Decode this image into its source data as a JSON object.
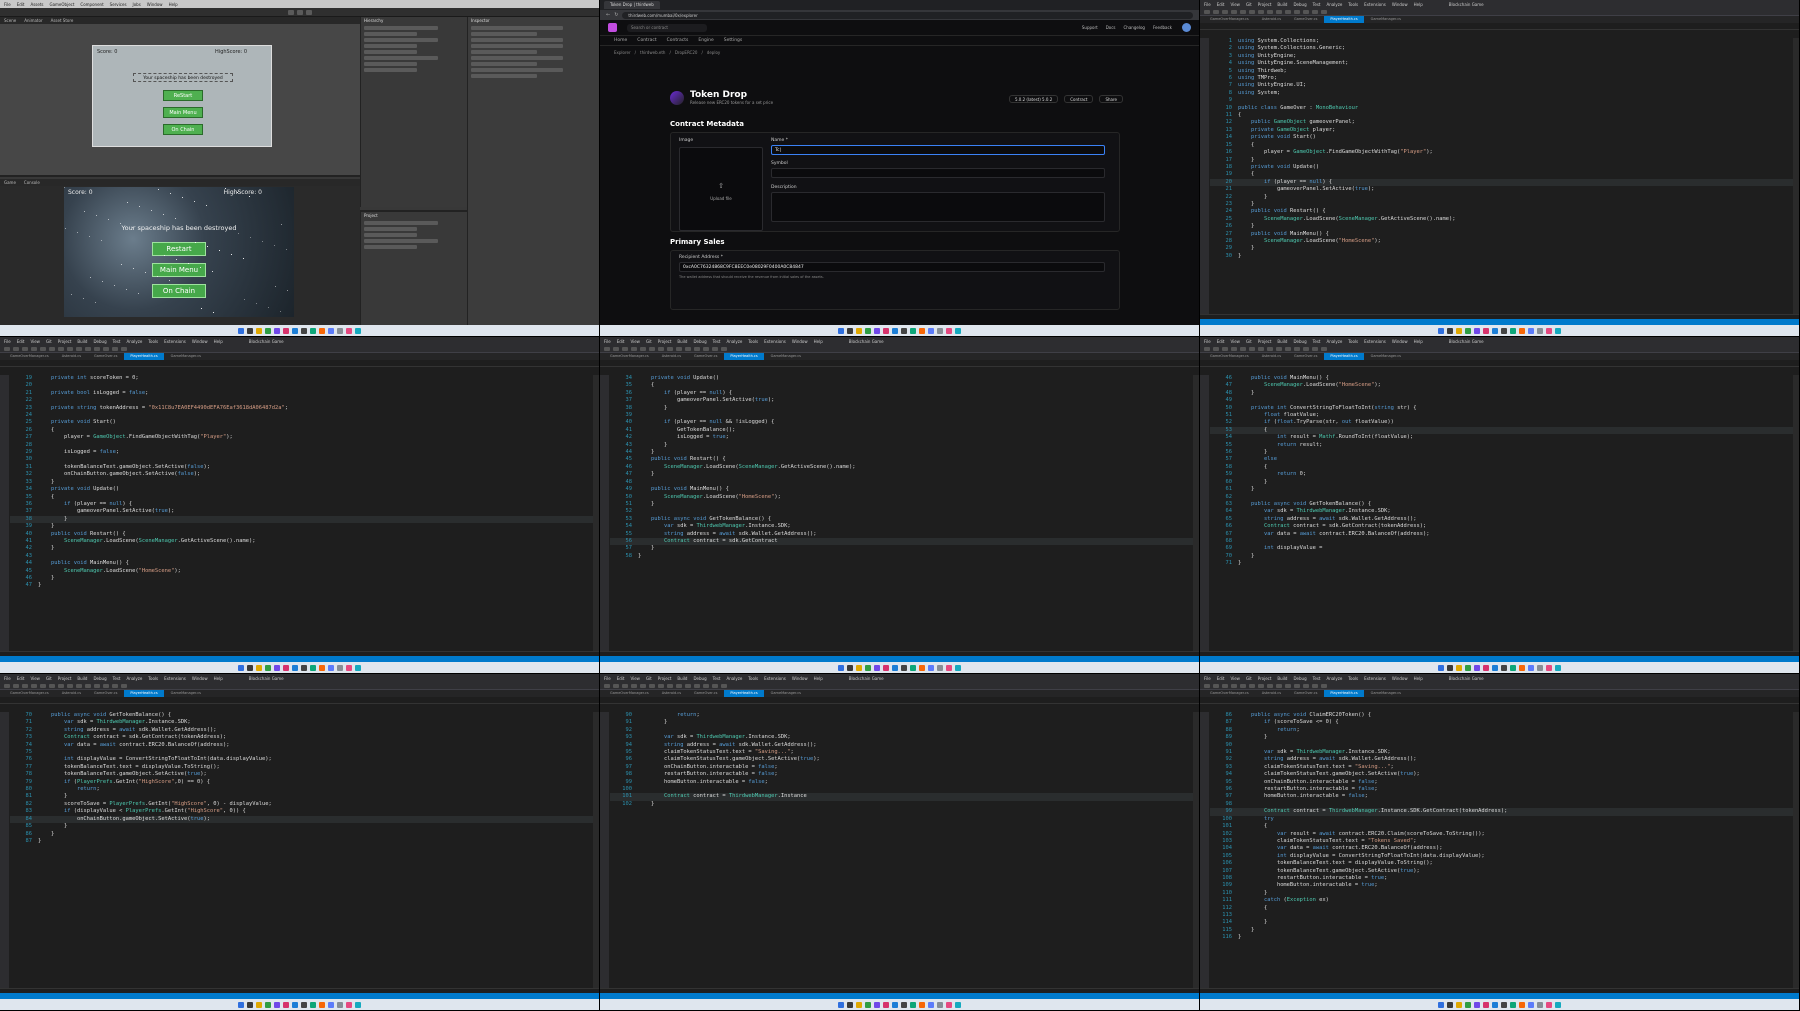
{
  "unity": {
    "menu": [
      "File",
      "Edit",
      "Assets",
      "GameObject",
      "Component",
      "Services",
      "Jobs",
      "Window",
      "Help"
    ],
    "scene_tabs": [
      "Scene",
      "Animator",
      "Asset Store"
    ],
    "game_tabs": [
      "Game",
      "Console"
    ],
    "canvas": {
      "score": "Score: 0",
      "high": "HighScore: 0",
      "message": "Your spaceship has been destroyed",
      "buttons": [
        "ReStart",
        "Main Menu",
        "On Chain"
      ]
    },
    "game": {
      "score": "Score: 0",
      "high": "HighScore: 0",
      "message": "Your spaceship has been destroyed",
      "buttons": [
        "Restart",
        "Main Menu",
        "On Chain"
      ]
    },
    "hierarchy_title": "Hierarchy",
    "project_title": "Project",
    "inspector_title": "Inspector"
  },
  "browser": {
    "tabs": [
      "Token Drop | thirdweb"
    ],
    "url": "thirdweb.com/mumbai/0x/explorer",
    "search_placeholder": "Search or contract",
    "nav_right": [
      "Support",
      "Docs",
      "Changelog",
      "Feedback"
    ],
    "tabs_row": [
      "Home",
      "Contract",
      "Contracts",
      "Engine",
      "Settings"
    ],
    "crumbs": [
      "Explorer",
      "thirdweb.eth",
      "DropERC20",
      "deploy"
    ],
    "title": "Token Drop",
    "description": "Release new ERC20 tokens for a set price",
    "version_label": "5.0.2 (latest) 5.0.2",
    "actions": [
      "Contract",
      "Share"
    ],
    "metadata_section": "Contract Metadata",
    "image_label": "Image",
    "upload_label": "Upload file",
    "name_label": "Name *",
    "name_value": "Tc|",
    "symbol_label": "Symbol",
    "description_label": "Description",
    "primary_section": "Primary Sales",
    "recipient_label": "Recipient Address *",
    "recipient_value": "0xcA0C76324868C9FC8EEC0e08029F0400A0C84847",
    "recipient_help": "The wallet address that should receive the revenue from initial sales of the assets."
  },
  "vs": {
    "menu": [
      "File",
      "Edit",
      "View",
      "Git",
      "Project",
      "Build",
      "Debug",
      "Test",
      "Analyze",
      "Tools",
      "Extensions",
      "Window",
      "Help"
    ],
    "solution": "Blockchain Game",
    "doc_tabs": [
      "GameOverManager.cs",
      "Asteroid.cs",
      "GameOver.cs",
      "PlayerHealth.cs",
      "GameManager.cs"
    ]
  },
  "code": {
    "c1": [
      [
        "1",
        "using System.Collections;"
      ],
      [
        "2",
        "using System.Collections.Generic;"
      ],
      [
        "3",
        "using UnityEngine;"
      ],
      [
        "4",
        "using UnityEngine.SceneManagement;"
      ],
      [
        "5",
        "using Thirdweb;"
      ],
      [
        "6",
        "using TMPro;"
      ],
      [
        "7",
        "using UnityEngine.UI;"
      ],
      [
        "8",
        "using System;"
      ],
      [
        "9",
        ""
      ],
      [
        "10",
        "public class GameOver : MonoBehaviour"
      ],
      [
        "11",
        "{"
      ],
      [
        "12",
        "    public GameObject gameoverPanel;"
      ],
      [
        "13",
        "    private GameObject player;"
      ],
      [
        "14",
        "    private void Start()"
      ],
      [
        "15",
        "    {"
      ],
      [
        "16",
        "        player = GameObject.FindGameObjectWithTag(\"Player\");"
      ],
      [
        "17",
        "    }"
      ],
      [
        "18",
        "    private void Update()"
      ],
      [
        "19",
        "    {"
      ],
      [
        "20",
        "        if (player == null) {"
      ],
      [
        "21",
        "            gameoverPanel.SetActive(true);"
      ],
      [
        "22",
        "        }"
      ],
      [
        "23",
        "    }"
      ],
      [
        "24",
        "    public void Restart() {"
      ],
      [
        "25",
        "        SceneManager.LoadScene(SceneManager.GetActiveScene().name);"
      ],
      [
        "26",
        "    }"
      ],
      [
        "27",
        "    public void MainMenu() {"
      ],
      [
        "28",
        "        SceneManager.LoadScene(\"HomeScene\");"
      ],
      [
        "29",
        "    }"
      ],
      [
        "30",
        "}"
      ]
    ],
    "b1": [
      [
        "19",
        "    private int scoreToken = 0;"
      ],
      [
        "20",
        ""
      ],
      [
        "21",
        "    private bool isLogged = false;"
      ],
      [
        "22",
        ""
      ],
      [
        "23",
        "    private string tokenAddress = \"0x11C8u7EA0EF4490dEFA76Eaf3618dA06487d2a\";"
      ],
      [
        "24",
        ""
      ],
      [
        "25",
        "    private void Start()"
      ],
      [
        "26",
        "    {"
      ],
      [
        "27",
        "        player = GameObject.FindGameObjectWithTag(\"Player\");"
      ],
      [
        "28",
        ""
      ],
      [
        "29",
        "        isLogged = false;"
      ],
      [
        "30",
        ""
      ],
      [
        "31",
        "        tokenBalanceText.gameObject.SetActive(false);"
      ],
      [
        "32",
        "        onChainButton.gameObject.SetActive(false);"
      ],
      [
        "33",
        "    }"
      ],
      [
        "34",
        "    private void Update()"
      ],
      [
        "35",
        "    {"
      ],
      [
        "36",
        "        if (player == null) {"
      ],
      [
        "37",
        "            gameoverPanel.SetActive(true);"
      ],
      [
        "38",
        "        }"
      ],
      [
        "39",
        "    }"
      ],
      [
        "40",
        "    public void Restart() {"
      ],
      [
        "41",
        "        SceneManager.LoadScene(SceneManager.GetActiveScene().name);"
      ],
      [
        "42",
        "    }"
      ],
      [
        "43",
        ""
      ],
      [
        "44",
        "    public void MainMenu() {"
      ],
      [
        "45",
        "        SceneManager.LoadScene(\"HomeScene\");"
      ],
      [
        "46",
        "    }"
      ],
      [
        "47",
        "}"
      ]
    ],
    "b2": [
      [
        "34",
        "    private void Update()"
      ],
      [
        "35",
        "    {"
      ],
      [
        "36",
        "        if (player == null) {"
      ],
      [
        "37",
        "            gameoverPanel.SetActive(true);"
      ],
      [
        "38",
        "        }"
      ],
      [
        "39",
        ""
      ],
      [
        "40",
        "        if (player == null && !isLogged) {"
      ],
      [
        "41",
        "            GetTokenBalance();"
      ],
      [
        "42",
        "            isLogged = true;"
      ],
      [
        "43",
        "        }"
      ],
      [
        "44",
        "    }"
      ],
      [
        "45",
        "    public void Restart() {"
      ],
      [
        "46",
        "        SceneManager.LoadScene(SceneManager.GetActiveScene().name);"
      ],
      [
        "47",
        "    }"
      ],
      [
        "48",
        ""
      ],
      [
        "49",
        "    public void MainMenu() {"
      ],
      [
        "50",
        "        SceneManager.LoadScene(\"HomeScene\");"
      ],
      [
        "51",
        "    }"
      ],
      [
        "52",
        ""
      ],
      [
        "53",
        "    public async void GetTokenBalance() {"
      ],
      [
        "54",
        "        var sdk = ThirdwebManager.Instance.SDK;"
      ],
      [
        "55",
        "        string address = await sdk.Wallet.GetAddress();"
      ],
      [
        "56",
        "        Contract contract = sdk.GetContract"
      ],
      [
        "57",
        "    }"
      ],
      [
        "58",
        "}"
      ]
    ],
    "b3": [
      [
        "46",
        "    public void MainMenu() {"
      ],
      [
        "47",
        "        SceneManager.LoadScene(\"HomeScene\");"
      ],
      [
        "48",
        "    }"
      ],
      [
        "49",
        ""
      ],
      [
        "50",
        "    private int ConvertStringToFloatToInt(string str) {"
      ],
      [
        "51",
        "        float floatValue;"
      ],
      [
        "52",
        "        if (float.TryParse(str, out floatValue))"
      ],
      [
        "53",
        "        {"
      ],
      [
        "54",
        "            int result = Mathf.RoundToInt(floatValue);"
      ],
      [
        "55",
        "            return result;"
      ],
      [
        "56",
        "        }"
      ],
      [
        "57",
        "        else"
      ],
      [
        "58",
        "        {"
      ],
      [
        "59",
        "            return 0;"
      ],
      [
        "60",
        "        }"
      ],
      [
        "61",
        "    }"
      ],
      [
        "62",
        ""
      ],
      [
        "63",
        "    public async void GetTokenBalance() {"
      ],
      [
        "64",
        "        var sdk = ThirdwebManager.Instance.SDK;"
      ],
      [
        "65",
        "        string address = await sdk.Wallet.GetAddress();"
      ],
      [
        "66",
        "        Contract contract = sdk.GetContract(tokenAddress);"
      ],
      [
        "67",
        "        var data = await contract.ERC20.BalanceOf(address);"
      ],
      [
        "68",
        ""
      ],
      [
        "69",
        "        int displayValue ="
      ],
      [
        "70",
        "    }"
      ],
      [
        "71",
        "}"
      ]
    ],
    "c1b": [
      [
        "70",
        "    public async void GetTokenBalance() {"
      ],
      [
        "71",
        "        var sdk = ThirdwebManager.Instance.SDK;"
      ],
      [
        "72",
        "        string address = await sdk.Wallet.GetAddress();"
      ],
      [
        "73",
        "        Contract contract = sdk.GetContract(tokenAddress);"
      ],
      [
        "74",
        "        var data = await contract.ERC20.BalanceOf(address);"
      ],
      [
        "75",
        ""
      ],
      [
        "76",
        "        int displayValue = ConvertStringToFloatToInt(data.displayValue);"
      ],
      [
        "77",
        "        tokenBalanceText.text = displayValue.ToString();"
      ],
      [
        "78",
        "        tokenBalanceText.gameObject.SetActive(true);"
      ],
      [
        "79",
        "        if (PlayerPrefs.GetInt(\"HighScore\",0) == 0) {"
      ],
      [
        "80",
        "            return;"
      ],
      [
        "81",
        "        }"
      ],
      [
        "82",
        "        scoreToSave = PlayerPrefs.GetInt(\"HighScore\", 0) - displayValue;"
      ],
      [
        "83",
        "        if (displayValue < PlayerPrefs.GetInt(\"HighScore\", 0)) {"
      ],
      [
        "84",
        "            onChainButton.gameObject.SetActive(true);"
      ],
      [
        "85",
        "        }"
      ],
      [
        "86",
        "    }"
      ],
      [
        "87",
        "}"
      ]
    ],
    "c2": [
      [
        "90",
        "            return;"
      ],
      [
        "91",
        "        }"
      ],
      [
        "92",
        ""
      ],
      [
        "93",
        "        var sdk = ThirdwebManager.Instance.SDK;"
      ],
      [
        "94",
        "        string address = await sdk.Wallet.GetAddress();"
      ],
      [
        "95",
        "        claimTokenStatusText.text = \"Saving...\";"
      ],
      [
        "96",
        "        claimTokenStatusText.gameObject.SetActive(true);"
      ],
      [
        "97",
        "        onChainButton.interactable = false;"
      ],
      [
        "98",
        "        restartButton.interactable = false;"
      ],
      [
        "99",
        "        homeButton.interactable = false;"
      ],
      [
        "100",
        ""
      ],
      [
        "101",
        "        Contract contract = ThirdwebManager.Instance"
      ],
      [
        "102",
        "    }"
      ]
    ],
    "c3": [
      [
        "86",
        "    public async void ClaimERC20Token() {"
      ],
      [
        "87",
        "        if (scoreToSave <= 0) {"
      ],
      [
        "88",
        "            return;"
      ],
      [
        "89",
        "        }"
      ],
      [
        "90",
        ""
      ],
      [
        "91",
        "        var sdk = ThirdwebManager.Instance.SDK;"
      ],
      [
        "92",
        "        string address = await sdk.Wallet.GetAddress();"
      ],
      [
        "93",
        "        claimTokenStatusText.text = \"Saving...\";"
      ],
      [
        "94",
        "        claimTokenStatusText.gameObject.SetActive(true);"
      ],
      [
        "95",
        "        onChainButton.interactable = false;"
      ],
      [
        "96",
        "        restartButton.interactable = false;"
      ],
      [
        "97",
        "        homeButton.interactable = false;"
      ],
      [
        "98",
        ""
      ],
      [
        "99",
        "        Contract contract = ThirdwebManager.Instance.SDK.GetContract(tokenAddress);"
      ],
      [
        "100",
        "        try"
      ],
      [
        "101",
        "        {"
      ],
      [
        "102",
        "            var result = await contract.ERC20.Claim(scoreToSave.ToString());"
      ],
      [
        "103",
        "            claimTokenStatusText.text = \"Tokens Saved\";"
      ],
      [
        "104",
        "            var data = await contract.ERC20.BalanceOf(address);"
      ],
      [
        "105",
        "            int displayValue = ConvertStringToFloatToInt(data.displayValue);"
      ],
      [
        "106",
        "            tokenBalanceText.text = displayValue.ToString();"
      ],
      [
        "107",
        "            tokenBalanceText.gameObject.SetActive(true);"
      ],
      [
        "108",
        "            restartButton.interactable = true;"
      ],
      [
        "109",
        "            homeButton.interactable = true;"
      ],
      [
        "110",
        "        }"
      ],
      [
        "111",
        "        catch (Exception ex)"
      ],
      [
        "112",
        "        {"
      ],
      [
        "113",
        ""
      ],
      [
        "114",
        "        }"
      ],
      [
        "115",
        "    }"
      ],
      [
        "116",
        "}"
      ]
    ]
  },
  "colors": {
    "vs_bg": "#1e1e1e",
    "vs_accent": "#007acc",
    "unity_green_button": "#46a84a",
    "thirdweb_bg": "#0e0e10"
  }
}
